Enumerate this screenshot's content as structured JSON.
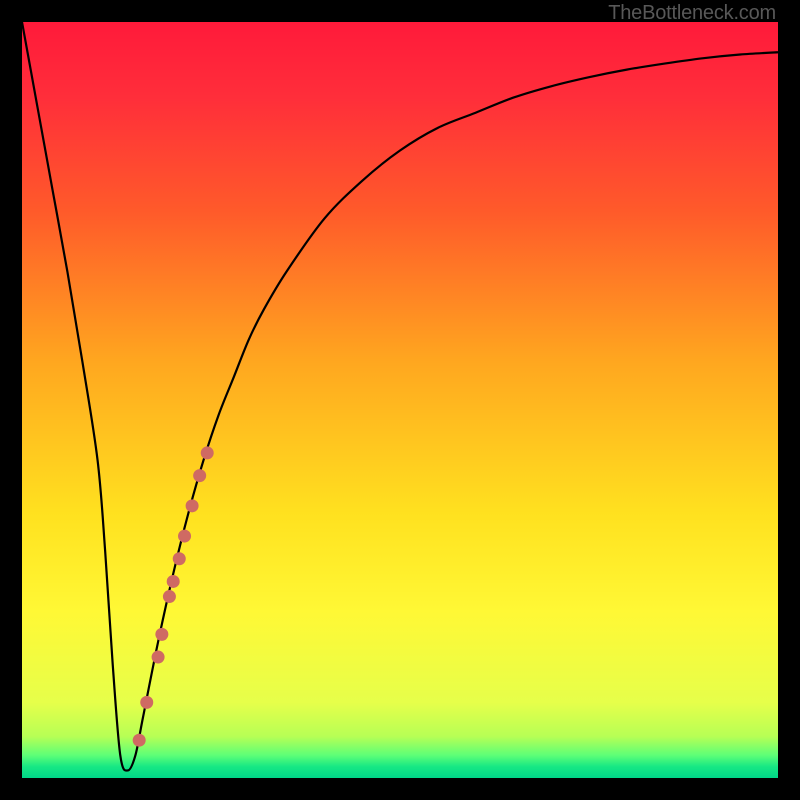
{
  "watermark": "TheBottleneck.com",
  "colors": {
    "curve": "#000000",
    "dots": "#cf6a63",
    "gradient_stops": [
      {
        "offset": 0.0,
        "color": "#ff1a3a"
      },
      {
        "offset": 0.1,
        "color": "#ff2e3a"
      },
      {
        "offset": 0.25,
        "color": "#ff5a2a"
      },
      {
        "offset": 0.45,
        "color": "#ffa71f"
      },
      {
        "offset": 0.65,
        "color": "#ffe11f"
      },
      {
        "offset": 0.78,
        "color": "#fff835"
      },
      {
        "offset": 0.9,
        "color": "#e6ff4a"
      },
      {
        "offset": 0.945,
        "color": "#b7ff55"
      },
      {
        "offset": 0.97,
        "color": "#5dff77"
      },
      {
        "offset": 0.985,
        "color": "#17e884"
      },
      {
        "offset": 1.0,
        "color": "#00d688"
      }
    ]
  },
  "chart_data": {
    "type": "line",
    "title": "",
    "xlabel": "",
    "ylabel": "",
    "xlim": [
      0,
      100
    ],
    "ylim": [
      0,
      100
    ],
    "series": [
      {
        "name": "bottleneck-curve",
        "x": [
          0,
          2,
          4,
          6,
          8,
          10,
          11,
          12,
          13,
          14,
          15,
          16,
          18,
          20,
          22,
          24,
          26,
          28,
          30,
          32,
          35,
          40,
          45,
          50,
          55,
          60,
          65,
          70,
          75,
          80,
          85,
          90,
          95,
          100
        ],
        "y": [
          100,
          89,
          78,
          67,
          55,
          42,
          30,
          15,
          3,
          1,
          3,
          8,
          18,
          27,
          35,
          42,
          48,
          53,
          58,
          62,
          67,
          74,
          79,
          83,
          86,
          88,
          90,
          91.5,
          92.7,
          93.7,
          94.5,
          95.2,
          95.7,
          96
        ]
      }
    ],
    "markers": {
      "name": "highlight-dots",
      "color": "#cf6a63",
      "points": [
        {
          "x": 15.5,
          "y": 5
        },
        {
          "x": 16.5,
          "y": 10
        },
        {
          "x": 18.0,
          "y": 16
        },
        {
          "x": 18.5,
          "y": 19
        },
        {
          "x": 19.5,
          "y": 24
        },
        {
          "x": 20.0,
          "y": 26
        },
        {
          "x": 20.8,
          "y": 29
        },
        {
          "x": 21.5,
          "y": 32
        },
        {
          "x": 22.5,
          "y": 36
        },
        {
          "x": 23.5,
          "y": 40
        },
        {
          "x": 24.5,
          "y": 43
        }
      ]
    }
  }
}
